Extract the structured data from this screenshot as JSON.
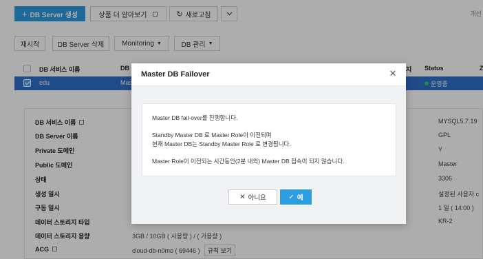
{
  "toolbar": {
    "create_label": "DB Server 생성",
    "learn_more_label": "상품 더 알아보기",
    "refresh_label": "새로고침",
    "right_hint": "개선"
  },
  "actions": {
    "restart_label": "재시작",
    "delete_label": "DB Server 삭제",
    "monitoring_label": "Monitoring",
    "manage_label": "DB 관리"
  },
  "table": {
    "headers": {
      "service_name": "DB 서비스 이름",
      "db": "DB",
      "partial": "지",
      "status": "Status",
      "z": "Z"
    },
    "row": {
      "service_name": "edu",
      "db": "Mas",
      "status": "운영중"
    }
  },
  "details": {
    "labels": [
      "DB 서비스 이름",
      "DB Server 이름",
      "Private 도메인",
      "Public 도메인",
      "상태",
      "생성 일시",
      "구동 일시",
      "데이터 스토리지 타입",
      "데이터 스토리지 용량",
      "ACG"
    ],
    "storage_value": "3GB / 10GB ( 사용량 ) / ( 가용량 )",
    "acg_value": "cloud-db-n0mo ( 69446 )",
    "acg_button": "규칙 보기",
    "right_values": [
      "MYSQL5.7.19",
      "GPL",
      "Y",
      "Master",
      "3306",
      "설정된 사용자 c",
      "1 일 ( 14:00 )",
      "",
      "KR-2"
    ]
  },
  "dialog": {
    "title": "Master DB Failover",
    "lines": [
      "Master DB fail-over를 진행합니다.",
      "Standby Master DB 로 Master Role이 이전되며",
      "현재 Master DB는 Standby Master Role 로 변경됩니다.",
      "Master Role이 이전되는 시간동안(2분 내외) Master DB 접속이 되지 않습니다."
    ],
    "no_label": "아니요",
    "yes_label": "예"
  }
}
